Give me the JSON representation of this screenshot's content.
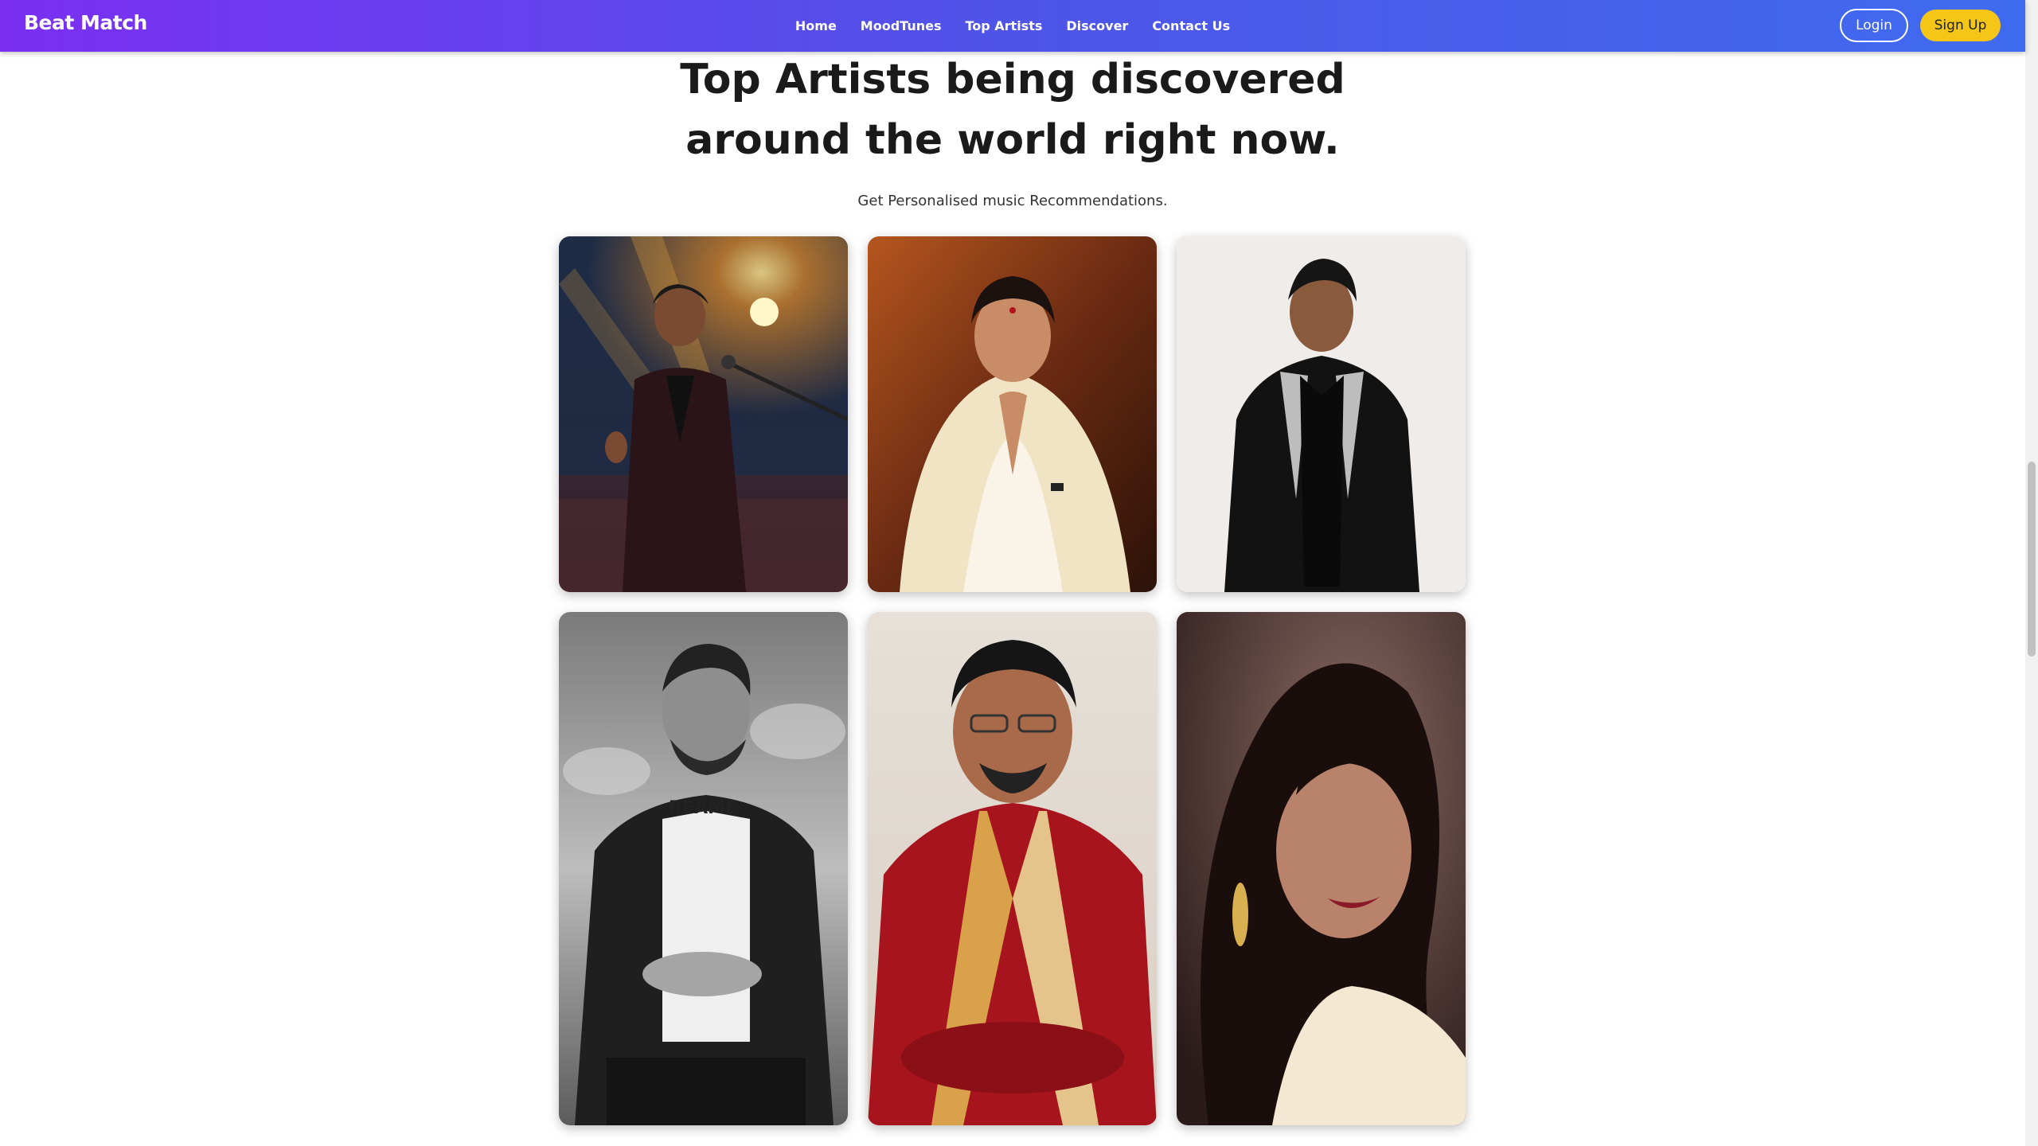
{
  "navbar": {
    "brand": "Beat Match",
    "links": [
      "Home",
      "MoodTunes",
      "Top Artists",
      "Discover",
      "Contact Us"
    ],
    "login_label": "Login",
    "signup_label": "Sign Up"
  },
  "main": {
    "headline_line1": "Top Artists being discovered",
    "headline_line2": "around the world right now.",
    "subheading": "Get Personalised music Recommendations."
  },
  "artists": [
    {
      "photo": "artist-photo-concert-singer"
    },
    {
      "photo": "artist-photo-elderly-singer-namaste"
    },
    {
      "photo": "artist-photo-singer-black-blazer"
    },
    {
      "photo": "artist-photo-bw-singer"
    },
    {
      "photo": "artist-photo-singer-red-kurta"
    },
    {
      "photo": "artist-photo-female-singer"
    }
  ],
  "colors": {
    "navbar_gradient_start": "#7b2ff2",
    "navbar_gradient_end": "#3f6bf0",
    "signup_button": "#f5c518",
    "headline_text": "#1a1a1a"
  }
}
